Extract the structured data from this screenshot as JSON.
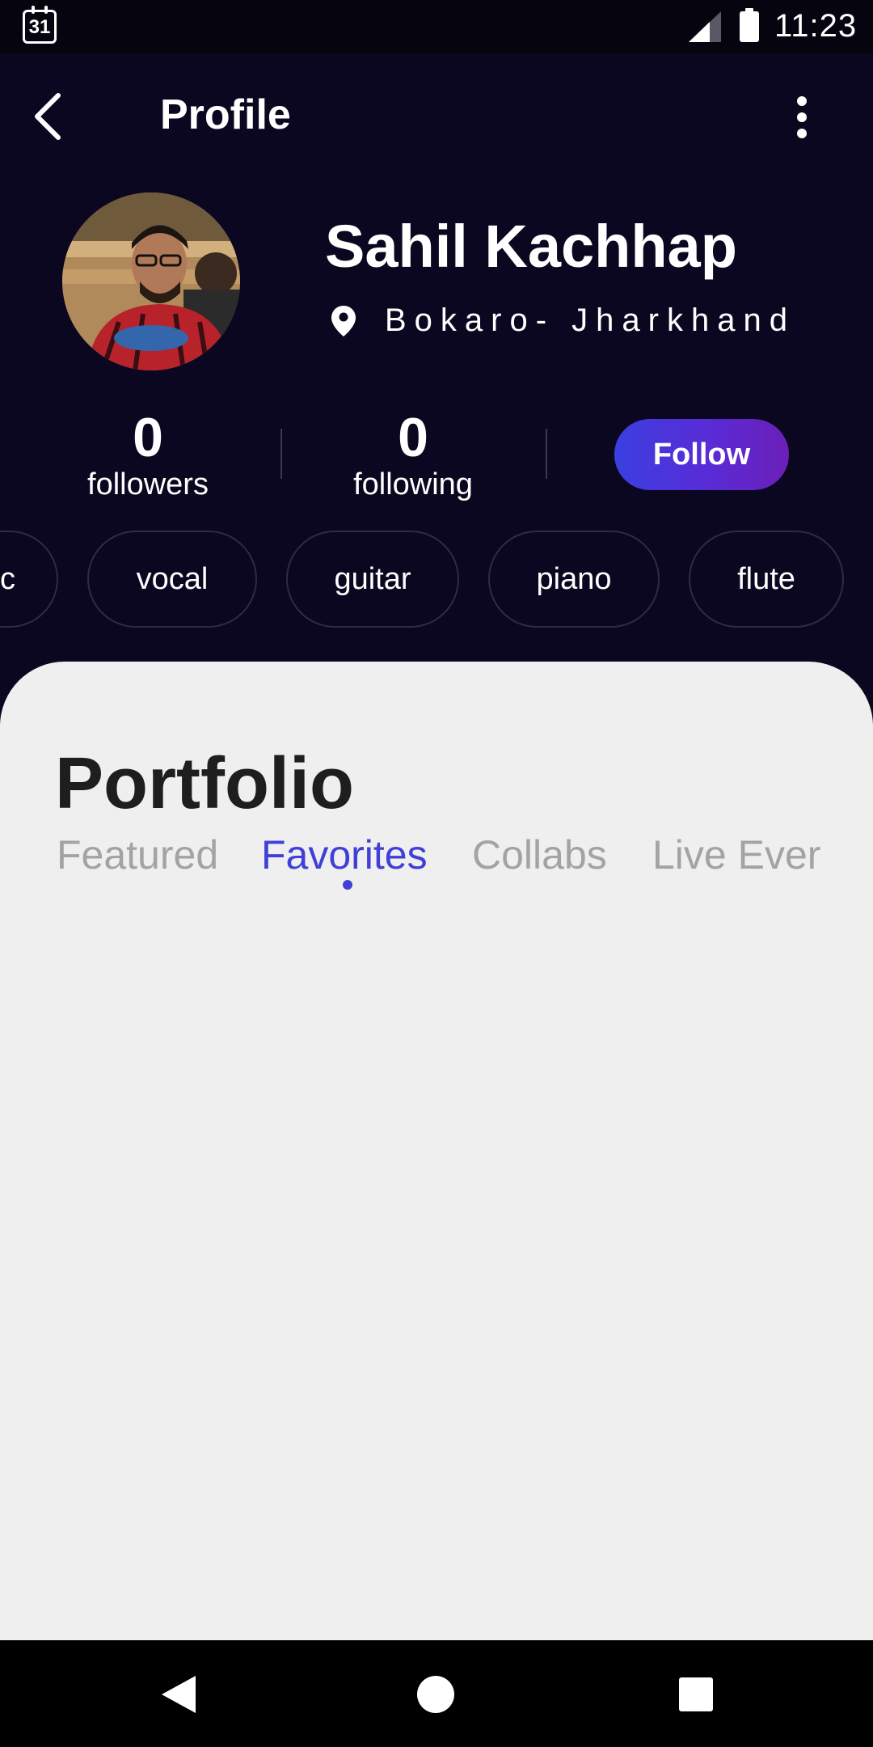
{
  "status_bar": {
    "calendar_day": "31",
    "time": "11:23"
  },
  "header": {
    "title": "Profile"
  },
  "profile": {
    "name": "Sahil Kachhap",
    "location": "Bokaro- Jharkhand"
  },
  "stats": {
    "followers_count": "0",
    "followers_label": "followers",
    "following_count": "0",
    "following_label": "following",
    "follow_button": "Follow"
  },
  "skills": [
    "c",
    "vocal",
    "guitar",
    "piano",
    "flute"
  ],
  "portfolio": {
    "title": "Portfolio",
    "tabs": [
      "Featured",
      "Favorites",
      "Collabs",
      "Live Ever"
    ],
    "active_tab": "Favorites"
  },
  "colors": {
    "background": "#0b0720",
    "accent": "#4040d8",
    "sheet": "#efefef"
  }
}
